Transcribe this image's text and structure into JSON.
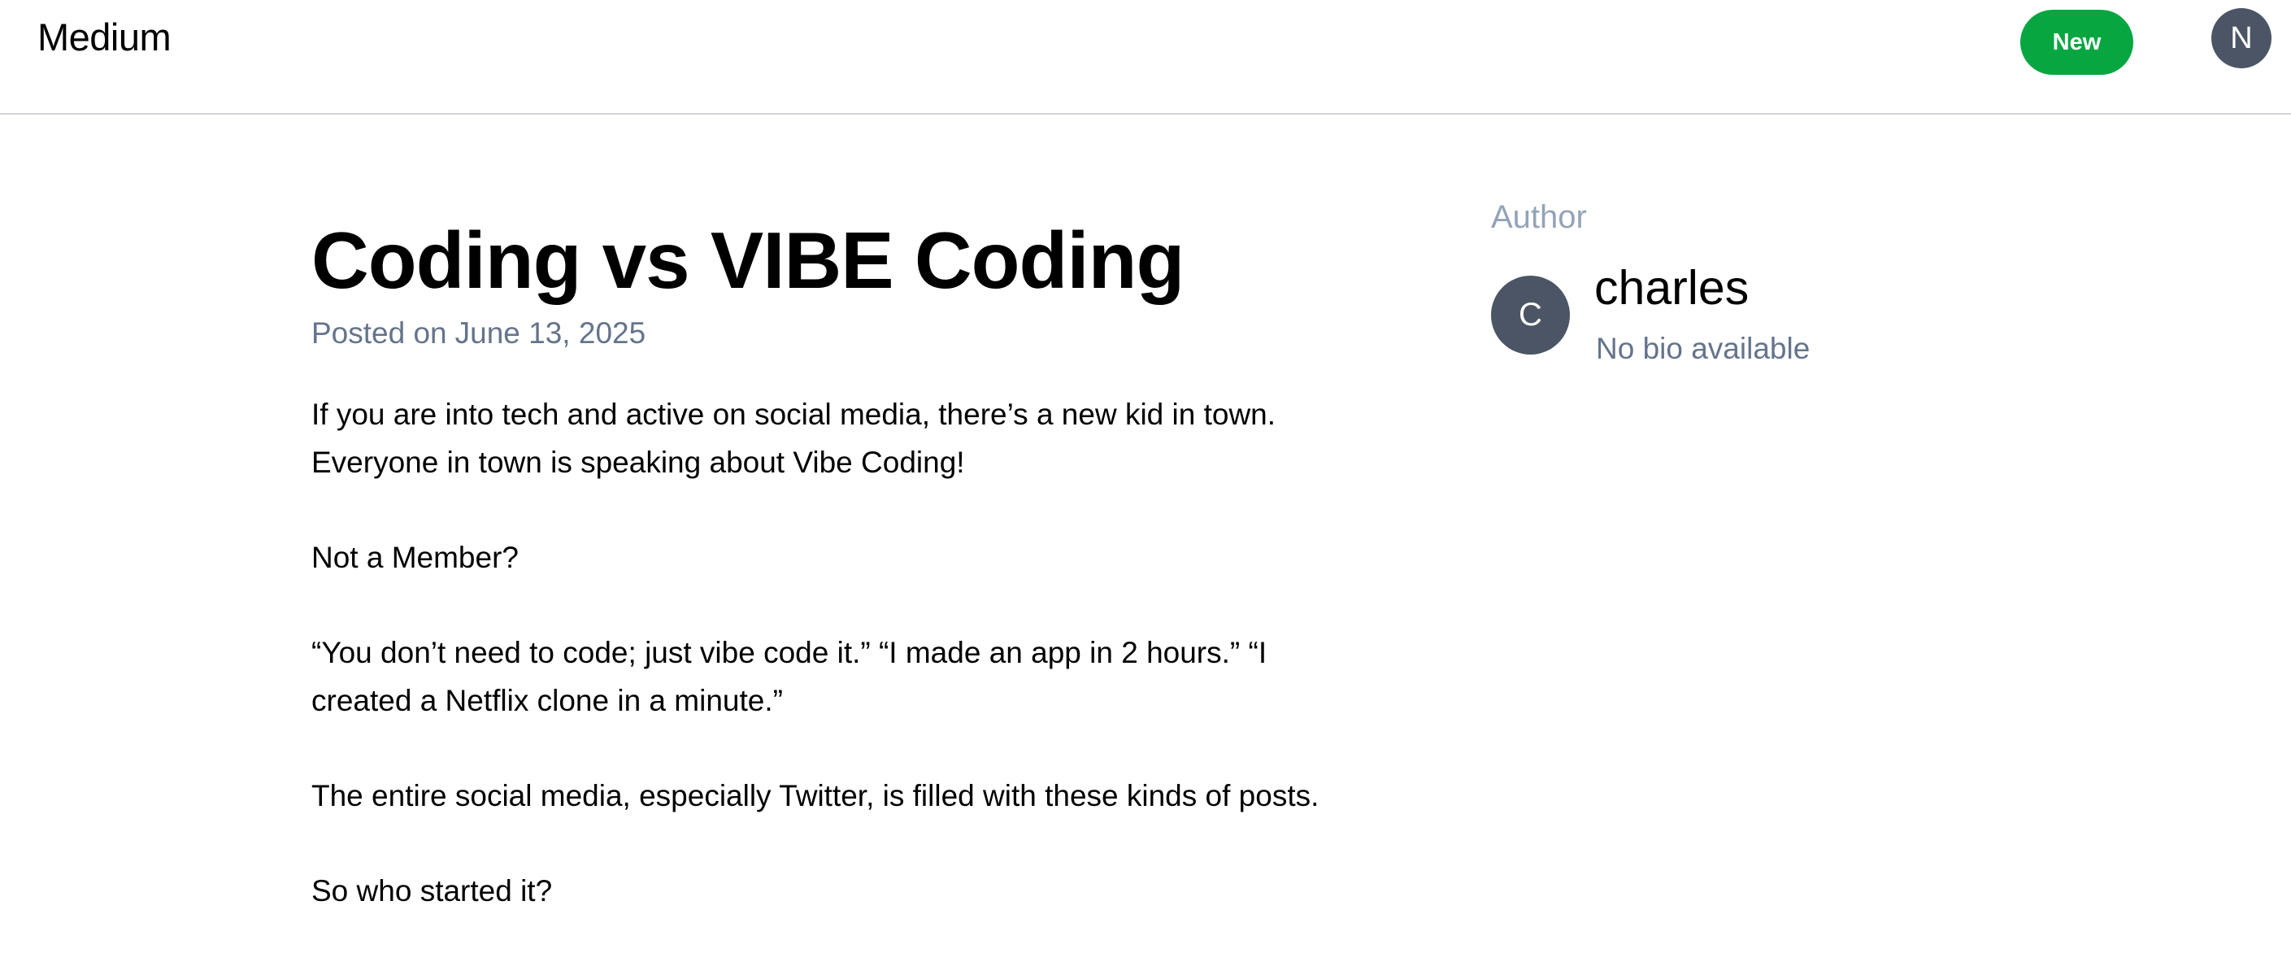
{
  "header": {
    "brand": "Medium",
    "new_button_label": "New",
    "user_initial": "N"
  },
  "article": {
    "title": "Coding vs VIBE Coding",
    "posted_label": "Posted on",
    "posted_date": "June 13, 2025",
    "paragraphs": [
      "If you are into tech and active on social media, there’s a new kid in town. Everyone in town is speaking about Vibe Coding!",
      "Not a Member?",
      "“You don’t need to code; just vibe code it.” “I made an app in 2 hours.” “I created a Netflix clone in a minute.”",
      "The entire social media, especially Twitter, is filled with these kinds of posts.",
      "So who started it?"
    ]
  },
  "author": {
    "heading": "Author",
    "initial": "C",
    "name": "charles",
    "bio": "No bio available"
  },
  "colors": {
    "accent_green": "#07a640",
    "avatar_bg": "#4b5565",
    "muted_text": "#64748b",
    "heading_muted": "#94a3b8"
  }
}
